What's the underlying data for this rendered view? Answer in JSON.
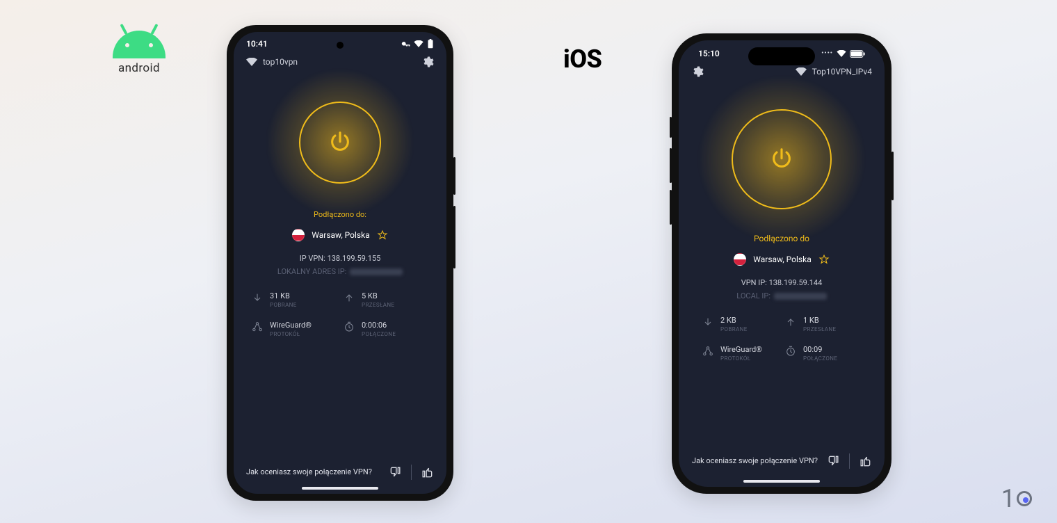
{
  "platforms": {
    "android_label": "android",
    "ios_label": "iOS"
  },
  "watermark": "1",
  "android": {
    "status_time": "10:41",
    "header_network": "top10vpn",
    "connected_label": "Podłączono do:",
    "location": "Warsaw, Polska",
    "ip_vpn_label": "IP VPN:",
    "ip_vpn_value": "138.199.59.155",
    "ip_local_label": "LOKALNY ADRES IP:",
    "stats": {
      "download_value": "31 KB",
      "download_label": "POBRANE",
      "upload_value": "5 KB",
      "upload_label": "PRZESŁANE",
      "protocol_value": "WireGuard®",
      "protocol_label": "PROTOKÓŁ",
      "duration_value": "0:00:06",
      "duration_label": "POŁĄCZONE"
    },
    "rating_question": "Jak oceniasz swoje połączenie VPN?"
  },
  "ios": {
    "status_time": "15:10",
    "header_network": "Top10VPN_IPv4",
    "connected_label": "Podłączono do",
    "location": "Warsaw, Polska",
    "ip_vpn_label": "VPN IP:",
    "ip_vpn_value": "138.199.59.144",
    "ip_local_label": "LOCAL IP:",
    "stats": {
      "download_value": "2 KB",
      "download_label": "POBRANE",
      "upload_value": "1 KB",
      "upload_label": "PRZESŁANE",
      "protocol_value": "WireGuard®",
      "protocol_label": "PROTOKÓŁ",
      "duration_value": "00:09",
      "duration_label": "POŁĄCZONE"
    },
    "rating_question": "Jak oceniasz swoje połączenie VPN?"
  }
}
